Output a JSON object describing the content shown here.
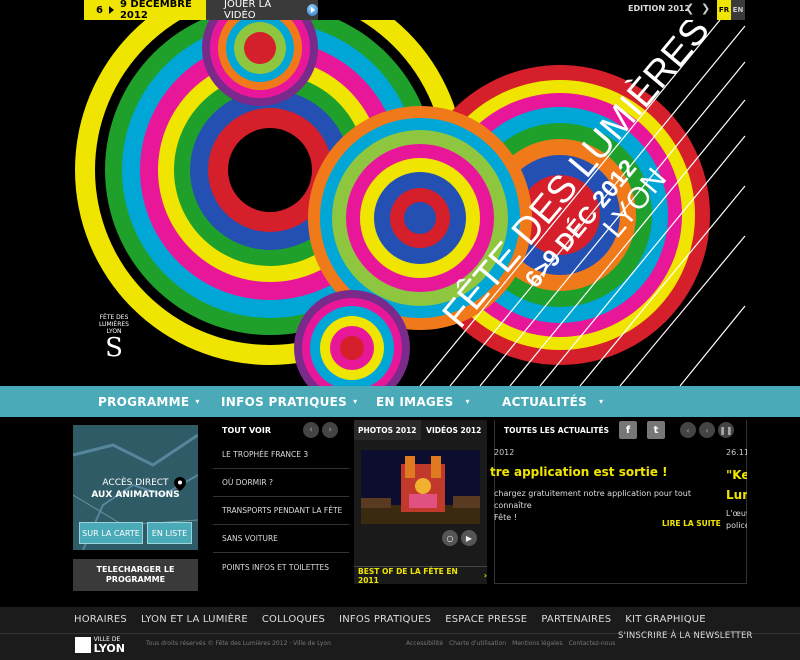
{
  "topbar": {
    "date_from": "6",
    "date_to": "9 DÉCEMBRE 2012",
    "video_label": "JOUER LA VIDÉO",
    "edition_label": "EDITION 2012",
    "lang_fr": "FR",
    "lang_en": "EN"
  },
  "hero": {
    "title_line1": "FÊTE DES LUMIÈRES",
    "title_line2": "6>9 DÉC 2012",
    "title_line3": "LYON",
    "logo_text": "FÊTE DES LUMIÈRES LYON"
  },
  "nav": {
    "items": [
      "PROGRAMME",
      "INFOS PRATIQUES",
      "EN IMAGES",
      "ACTUALITÉS"
    ]
  },
  "access": {
    "line1": "ACCÈS DIRECT",
    "line2": "AUX ANIMATIONS",
    "map_button": "SUR LA CARTE",
    "list_button": "EN LISTE",
    "download_line1": "TELECHARGER LE",
    "download_line2": "PROGRAMME"
  },
  "practical": {
    "heading": "TOUT VOIR",
    "items": [
      "LE TROPHÉE FRANCE 3",
      "OÙ DORMIR ?",
      "TRANSPORTS PENDANT LA FÊTE",
      "SANS VOITURE",
      "POINTS INFOS ET TOILETTES"
    ]
  },
  "media": {
    "tab_photos": "PHOTOS 2012",
    "tab_videos": "VIDÉOS 2012",
    "best_of": "BEST OF DE LA FÊTE EN 2011"
  },
  "news": {
    "heading": "TOUTES LES ACTUALITÉS",
    "date1": "2012",
    "title1": "tre application est sortie !",
    "body1_line1": "chargez gratuitement notre application pour tout connaître",
    "body1_line2": "Fête !",
    "read_more": "LIRE LA SUITE",
    "date2": "26.11.",
    "title2_line1": "\"Ke",
    "title2_line2": "Lum",
    "body2_line1": "L'œuv",
    "body2_line2": "policé"
  },
  "footer": {
    "links": [
      "HORAIRES",
      "LYON ET LA LUMIÈRE",
      "COLLOQUES",
      "INFOS PRATIQUES",
      "ESPACE PRESSE",
      "PARTENAIRES",
      "KIT GRAPHIQUE"
    ],
    "ville_de": "VILLE DE",
    "lyon": "LYON",
    "copyright": "Tous droits réservés © Fête des Lumières 2012 · Ville de Lyon",
    "legal": [
      "Accessibilité",
      "Charte d'utilisation",
      "Mentions légales",
      "Contactez-nous"
    ],
    "newsletter": "S'INSCRIRE À LA NEWSLETTER"
  },
  "colors": {
    "accent_yellow": "#f0e500",
    "nav_teal": "#4aaab8",
    "background": "#000000"
  }
}
